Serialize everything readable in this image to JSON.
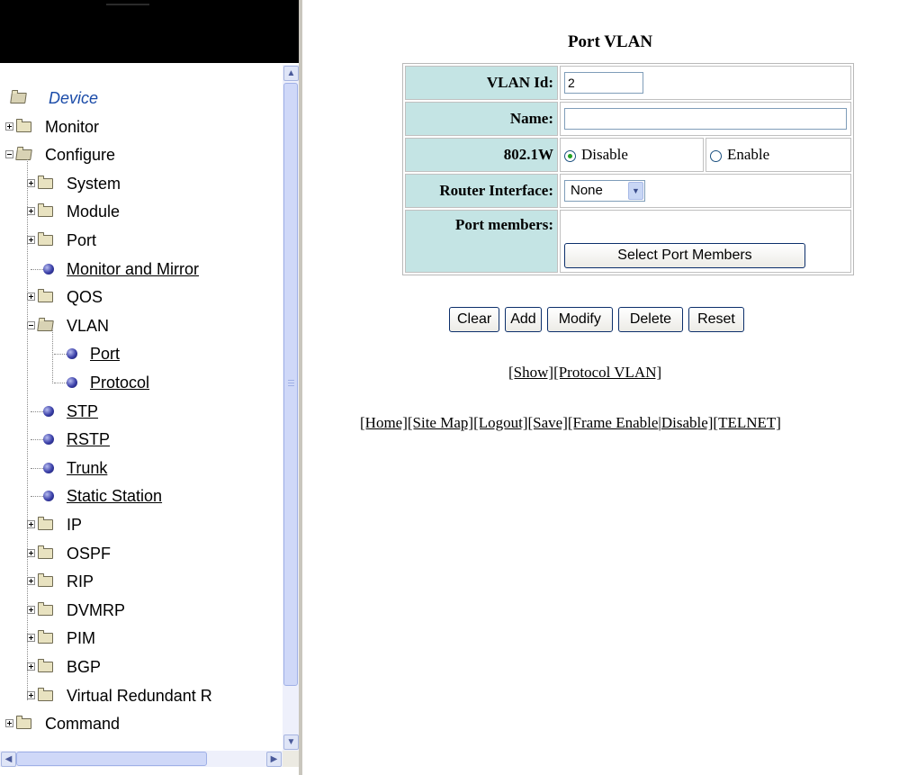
{
  "tree": {
    "root": "Device",
    "items": [
      {
        "label": "Monitor",
        "type": "folder",
        "expanded": false,
        "level": 0
      },
      {
        "label": "Configure",
        "type": "folder",
        "expanded": true,
        "level": 0
      },
      {
        "label": "System",
        "type": "folder",
        "expanded": false,
        "level": 1
      },
      {
        "label": "Module",
        "type": "folder",
        "expanded": false,
        "level": 1
      },
      {
        "label": "Port",
        "type": "folder",
        "expanded": false,
        "level": 1
      },
      {
        "label": "Monitor and Mirror",
        "type": "leaf",
        "level": 1
      },
      {
        "label": "QOS",
        "type": "folder",
        "expanded": false,
        "level": 1
      },
      {
        "label": "VLAN",
        "type": "folder",
        "expanded": true,
        "level": 1
      },
      {
        "label": "Port",
        "type": "leaf",
        "level": 2
      },
      {
        "label": "Protocol",
        "type": "leaf",
        "level": 2
      },
      {
        "label": "STP",
        "type": "leaf",
        "level": 1
      },
      {
        "label": "RSTP",
        "type": "leaf",
        "level": 1
      },
      {
        "label": "Trunk",
        "type": "leaf",
        "level": 1
      },
      {
        "label": "Static Station",
        "type": "leaf",
        "level": 1
      },
      {
        "label": "IP",
        "type": "folder",
        "expanded": false,
        "level": 1
      },
      {
        "label": "OSPF",
        "type": "folder",
        "expanded": false,
        "level": 1
      },
      {
        "label": "RIP",
        "type": "folder",
        "expanded": false,
        "level": 1
      },
      {
        "label": "DVMRP",
        "type": "folder",
        "expanded": false,
        "level": 1
      },
      {
        "label": "PIM",
        "type": "folder",
        "expanded": false,
        "level": 1
      },
      {
        "label": "BGP",
        "type": "folder",
        "expanded": false,
        "level": 1
      },
      {
        "label": "Virtual Redundant R",
        "type": "folder",
        "expanded": false,
        "level": 1
      },
      {
        "label": "Command",
        "type": "folder",
        "expanded": false,
        "level": 0
      }
    ]
  },
  "page": {
    "title": "Port VLAN",
    "form": {
      "vlan_id_label": "VLAN Id:",
      "vlan_id_value": "2",
      "name_label": "Name:",
      "name_value": "",
      "w8021_label": "802.1W",
      "disable_label": "Disable",
      "enable_label": "Enable",
      "selected": "Disable",
      "router_label": "Router Interface:",
      "router_value": "None",
      "port_members_label": "Port members:",
      "select_members_button": "Select Port Members"
    },
    "buttons": {
      "clear": "Clear",
      "add": "Add",
      "modify": "Modify",
      "delete": "Delete",
      "reset": "Reset"
    },
    "links1": {
      "show": "[Show]",
      "protocol_vlan": "[Protocol VLAN]"
    },
    "links2": {
      "home": "[Home]",
      "site_map": "[Site Map]",
      "logout": "[Logout]",
      "save": "[Save]",
      "frame_enable": "[Frame Enable",
      "sep": "|",
      "disable": "Disable]",
      "telnet": "[TELNET]"
    }
  },
  "colors": {
    "label_cell": "#c4e4e4",
    "banner": "#000000"
  },
  "icons": {
    "folder": "folder-icon",
    "leaf": "bullet-icon"
  }
}
